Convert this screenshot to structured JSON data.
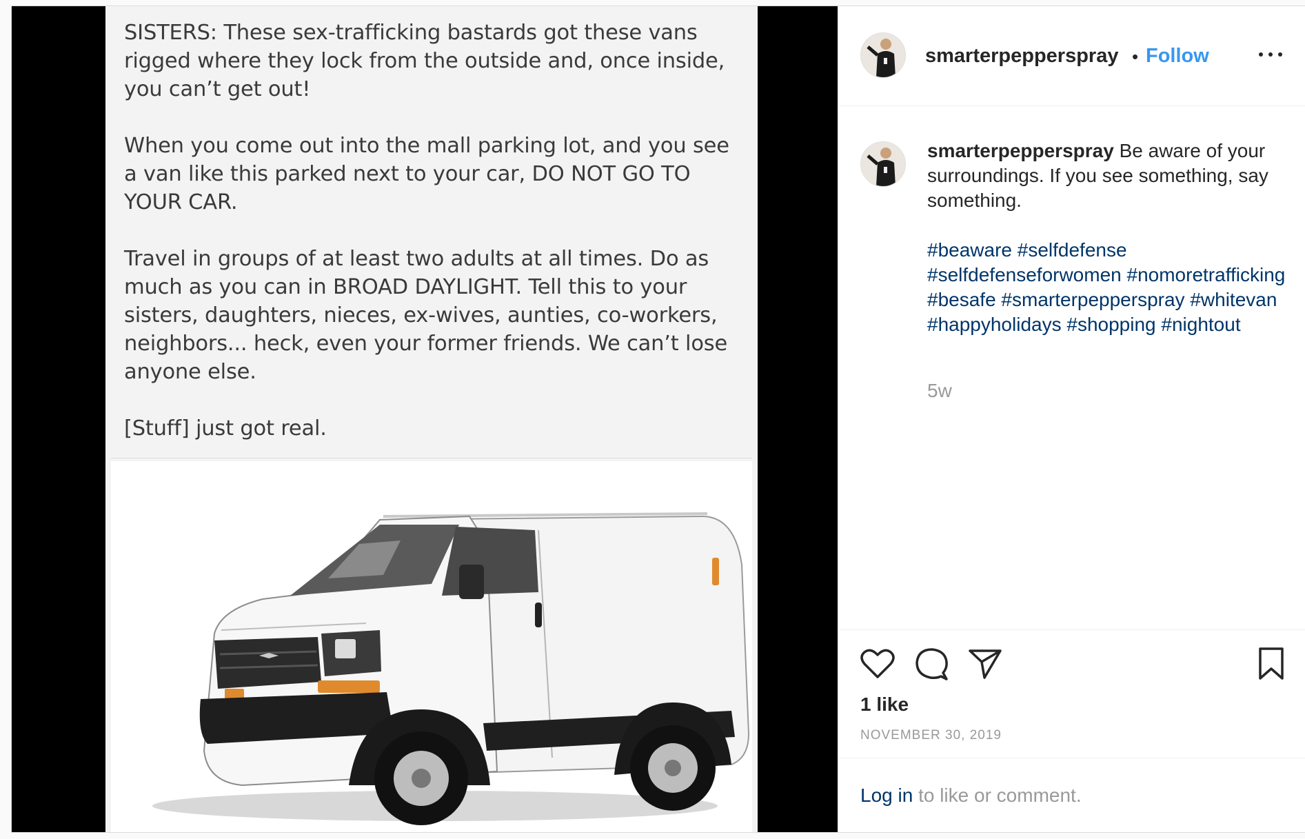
{
  "post": {
    "username": "smarterpepperspray",
    "follow_label": "Follow",
    "separator": "•",
    "more_icon": "more-options-icon"
  },
  "image_text": {
    "paragraphs": [
      "SISTERS:  These sex-trafficking bastards got these vans rigged where they lock from the outside and, once inside, you can’t get out!",
      "When you come out into the mall parking lot, and you see a van like this parked next to your car, DO NOT GO TO YOUR CAR.",
      "Travel in groups of at least two adults at all times.  Do as much as you can in BROAD DAYLIGHT.  Tell this to your sisters, daughters, nieces, ex-wives, aunties, co-workers, neighbors... heck, even your former friends.  We can’t lose anyone else.",
      "[Stuff] just got real."
    ]
  },
  "caption": {
    "username": "smarterpepperspray",
    "text": " Be aware of your surroundings. If you see something, say something.",
    "hashtags": [
      "#beaware",
      "#selfdefense",
      "#selfdefenseforwomen",
      "#nomoretrafficking",
      "#besafe",
      "#smarterpepperspray",
      "#whitevan",
      "#happyholidays",
      "#shopping",
      "#nightout"
    ],
    "age": "5w"
  },
  "actions": {
    "likes": "1 like",
    "date": "NOVEMBER 30, 2019",
    "icons": [
      "heart-icon",
      "comment-icon",
      "share-icon",
      "bookmark-icon"
    ]
  },
  "login": {
    "link": "Log in",
    "rest": " to like or comment."
  },
  "colors": {
    "link_blue": "#3897f0",
    "hashtag": "#003569",
    "muted": "#999999",
    "text": "#262626"
  }
}
